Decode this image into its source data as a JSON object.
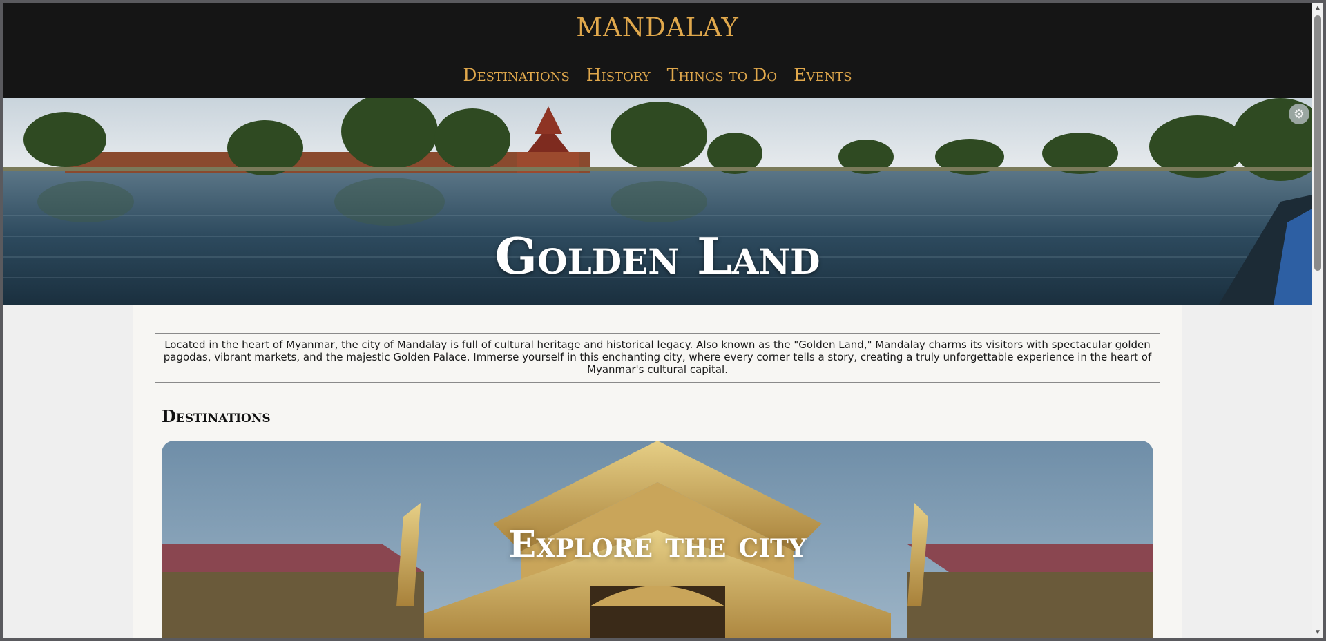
{
  "site": {
    "logo": "MANDALAY",
    "nav": [
      {
        "label": "Destinations"
      },
      {
        "label": "History"
      },
      {
        "label": "Things to Do"
      },
      {
        "label": "Events"
      }
    ]
  },
  "hero": {
    "title": "Golden Land"
  },
  "main": {
    "intro": "Located in the heart of Myanmar, the city of Mandalay is full of cultural heritage and historical legacy. Also known as the \"Golden Land,\" Mandalay charms its visitors with spectacular golden pagodas, vibrant markets, and the majestic Golden Palace. Immerse yourself in this enchanting city, where every corner tells a story, creating a truly unforgettable experience in the heart of Myanmar's cultural capital.",
    "section_title": "Destinations",
    "card_title": "Explore the city"
  },
  "icons": {
    "settings": "settings-icon",
    "scroll_up": "chevron-up-icon",
    "scroll_down": "chevron-down-icon"
  },
  "colors": {
    "header_bg": "#151515",
    "accent_gold": "#e0a84c",
    "content_bg": "#f7f6f3"
  }
}
